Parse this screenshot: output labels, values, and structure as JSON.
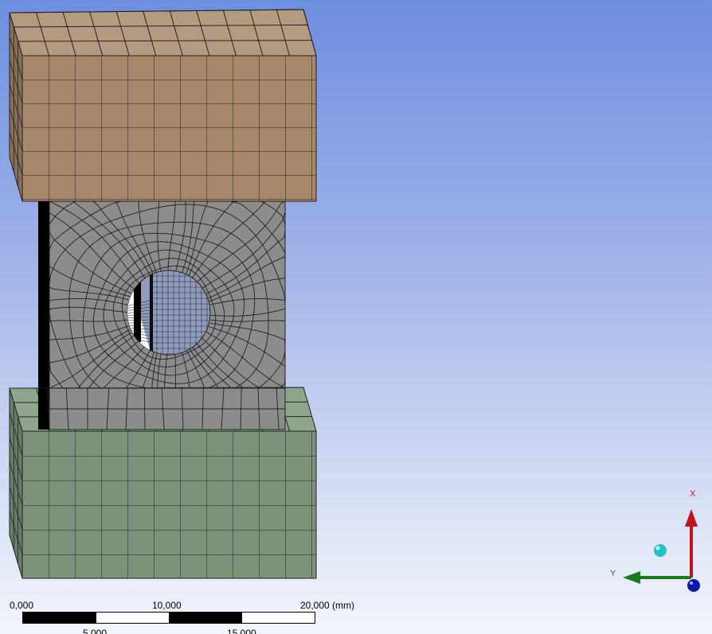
{
  "scale": {
    "labels_top": [
      "0,000",
      "10,000",
      "20,000 (mm)"
    ],
    "labels_bottom": [
      "5,000",
      "15,000"
    ]
  },
  "triad": {
    "x_label": "X",
    "y_label": "Y",
    "x_color": "#c0141c",
    "y_color": "#1a7a1a",
    "z_color": "#0a1aa8",
    "iso_ball_color": "#22c1c9"
  },
  "colors": {
    "top_block": "#a7876a",
    "bottom_block": "#7c937a",
    "specimen": "#8c8c8c",
    "hole": "#8e9bbd"
  }
}
